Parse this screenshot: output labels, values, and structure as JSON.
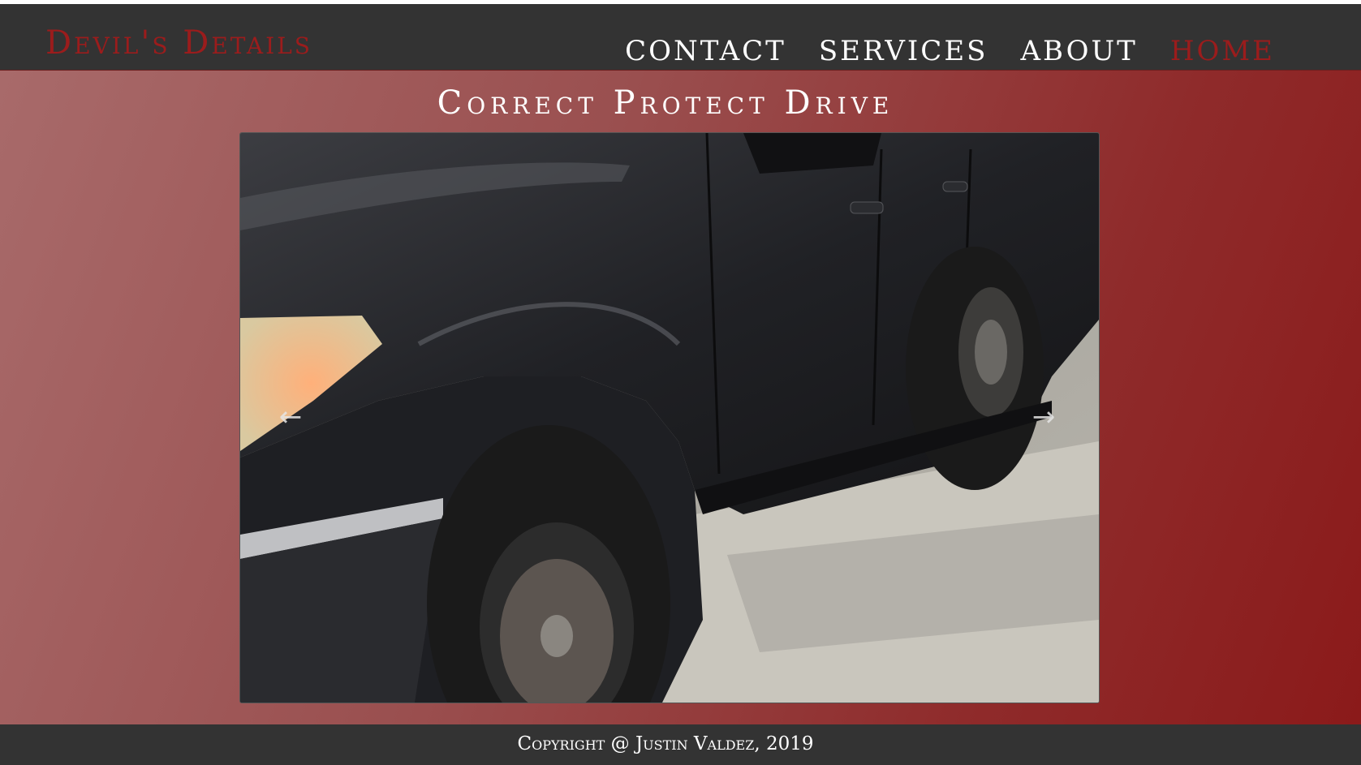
{
  "navbar": {
    "brand": "Devil's Details",
    "links": [
      {
        "label": "CONTACT",
        "active": false
      },
      {
        "label": "SERVICES",
        "active": false
      },
      {
        "label": "ABOUT",
        "active": false
      },
      {
        "label": "HOME",
        "active": true
      }
    ]
  },
  "main": {
    "tagline": "Correct Protect Drive",
    "carousel": {
      "prev_icon": "arrow-left-icon",
      "next_icon": "arrow-right-icon",
      "prev_glyph": "←",
      "next_glyph": "→"
    }
  },
  "footer": {
    "copyright": "Copyright @ Justin Valdez, 2019"
  },
  "colors": {
    "nav_bg": "#333333",
    "brand": "#9b1c1c",
    "active_link": "#9b1c1c",
    "gradient_start": "#a86a6a",
    "gradient_end": "#8b1a1a"
  }
}
